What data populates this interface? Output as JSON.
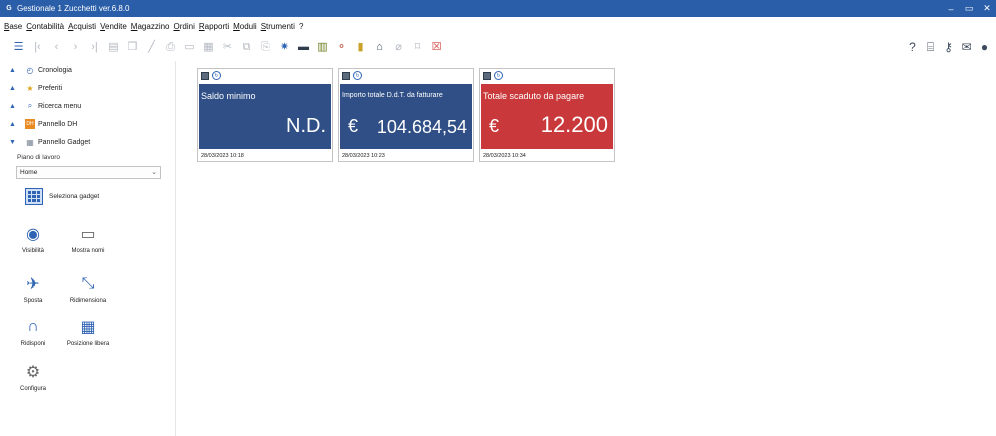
{
  "window": {
    "title": "Gestionale 1 Zucchetti ver.6.8.0",
    "colors": {
      "titlebar": "#2a5ea8",
      "accent_blue": "#2f64b4",
      "tile_blue": "#2f4f86",
      "tile_red": "#c9383a"
    }
  },
  "menu": [
    "Base",
    "Contabilità",
    "Acquisti",
    "Vendite",
    "Magazzino",
    "Ordini",
    "Rapporti",
    "Moduli",
    "Strumenti",
    "?"
  ],
  "toolbar": {
    "icons": [
      "menu-icon",
      "first-record-icon",
      "previous-icon",
      "next-icon",
      "last-record-icon",
      "new-record-icon",
      "duplicate-icon",
      "edit-icon",
      "print-icon",
      "preview-icon",
      "calculator-icon",
      "cut-icon",
      "copy-icon",
      "paste-icon",
      "settings-gear-icon",
      "bookmark-icon",
      "chart-icon",
      "hierarchy-icon",
      "bookmark-vertical-icon",
      "bank-icon",
      "attach-icon",
      "frame-icon",
      "close-window-icon"
    ],
    "right_icons": [
      "help-icon",
      "barcode-icon",
      "key-icon",
      "mail-icon",
      "user-icon"
    ]
  },
  "sidebar": {
    "sections": [
      {
        "label": "Cronologia",
        "icon": "clock-icon"
      },
      {
        "label": "Preferiti",
        "icon": "star-icon"
      },
      {
        "label": "Ricerca menu",
        "icon": "search-icon"
      },
      {
        "label": "Pannello DH",
        "icon": "dh-icon"
      },
      {
        "label": "Pannello Gadget",
        "icon": "gadget-panel-icon"
      }
    ],
    "piano_label": "Piano di lavoro",
    "piano_value": "Home",
    "select_gadget_label": "Seleziona gadget",
    "tools": {
      "visibilita": "Visibilità",
      "mostra_nomi": "Mostra nomi",
      "sposta": "Sposta",
      "ridimensiona": "Ridimensiona",
      "ridisponi": "Ridisponi",
      "posizione_libera": "Posizione libera",
      "configura": "Configura"
    }
  },
  "gadgets": [
    {
      "title": "Saldo minimo",
      "currency": "",
      "value": "N.D.",
      "timestamp": "28/03/2023 10:18",
      "color": "#2f4f86"
    },
    {
      "title": "Importo totale D.d.T. da fatturare",
      "currency": "€",
      "value": "104.684,54",
      "timestamp": "28/03/2023 10:23",
      "color": "#2f4f86"
    },
    {
      "title": "Totale scaduto da pagare",
      "currency": "€",
      "value": "12.200",
      "timestamp": "28/03/2023 10:34",
      "color": "#c9383a"
    }
  ]
}
